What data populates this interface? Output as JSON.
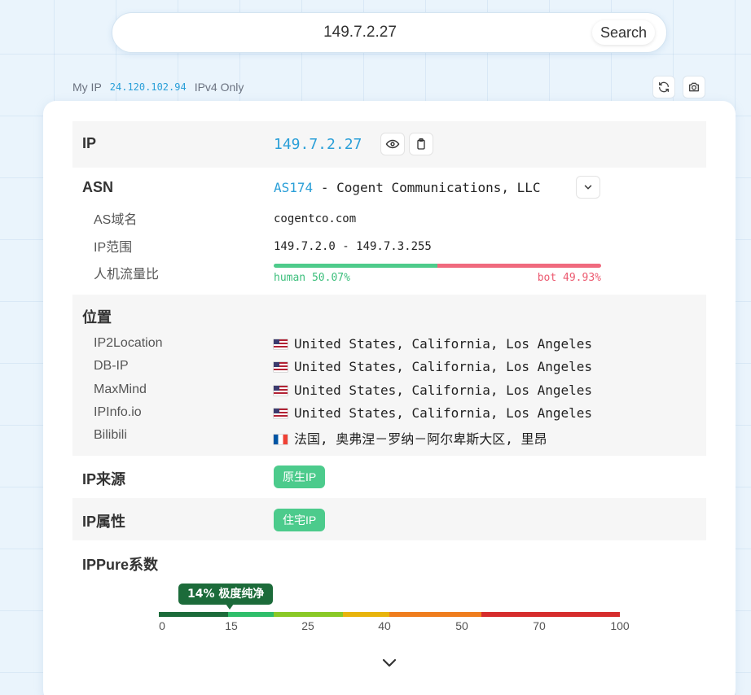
{
  "search": {
    "value": "149.7.2.27",
    "button_label": "Search"
  },
  "my_ip": {
    "label": "My IP",
    "address": "24.120.102.94",
    "mode": "IPv4 Only"
  },
  "toolbar": {
    "refresh_icon": "refresh-icon",
    "screenshot_icon": "camera-icon"
  },
  "ip_section": {
    "label": "IP",
    "value": "149.7.2.27",
    "eye_icon": "eye-icon",
    "copy_icon": "clipboard-icon"
  },
  "asn": {
    "label": "ASN",
    "as_number": "AS174",
    "org": "- Cogent Communications, LLC",
    "expand_icon": "chevron-down-icon",
    "domain_label": "AS域名",
    "domain": "cogentco.com",
    "range_label": "IP范围",
    "range": "149.7.2.0 - 149.7.3.255",
    "traffic_label": "人机流量比",
    "human_text": "human 50.07%",
    "bot_text": "bot 49.93%",
    "human_percent": 50.07,
    "bot_percent": 49.93,
    "colors": {
      "human": "#4ecb8b",
      "bot": "#f06a7e"
    }
  },
  "location": {
    "label": "位置",
    "sources": [
      {
        "name": "IP2Location",
        "flag": "us",
        "text": "United States, California, Los Angeles"
      },
      {
        "name": "DB-IP",
        "flag": "us",
        "text": "United States, California, Los Angeles"
      },
      {
        "name": "MaxMind",
        "flag": "us",
        "text": "United States, California, Los Angeles"
      },
      {
        "name": "IPInfo.io",
        "flag": "us",
        "text": "United States, California, Los Angeles"
      },
      {
        "name": "Bilibili",
        "flag": "fr",
        "text": "法国, 奥弗涅－罗纳－阿尔卑斯大区, 里昂"
      }
    ]
  },
  "ip_source": {
    "label": "IP来源",
    "badge": "原生IP"
  },
  "ip_attr": {
    "label": "IP属性",
    "badge": "住宅IP"
  },
  "ippure": {
    "label": "IPPure系数",
    "score_label": "14% 极度纯净",
    "score": 14,
    "scale_max": 100,
    "ticks": [
      "0",
      "15",
      "25",
      "40",
      "50",
      "70",
      "100"
    ],
    "segments": [
      {
        "from": 0,
        "to": 15,
        "color": "#1c6b3a"
      },
      {
        "from": 15,
        "to": 25,
        "color": "#2fbe6a"
      },
      {
        "from": 25,
        "to": 40,
        "color": "#8ac926"
      },
      {
        "from": 40,
        "to": 50,
        "color": "#e8b40c"
      },
      {
        "from": 50,
        "to": 70,
        "color": "#ef7d1e"
      },
      {
        "from": 70,
        "to": 100,
        "color": "#d62d2d"
      }
    ]
  },
  "footer": {
    "expand_icon": "chevron-down-icon"
  }
}
